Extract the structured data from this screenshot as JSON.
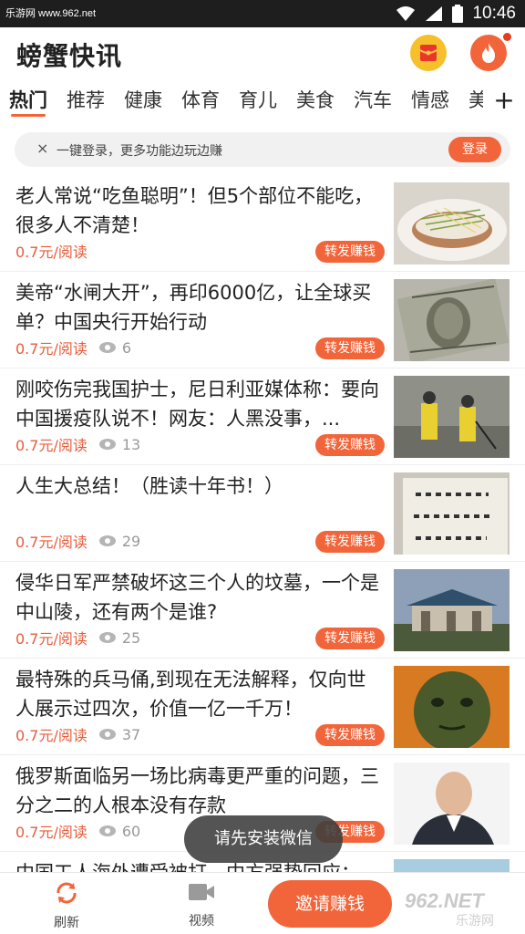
{
  "statusbar": {
    "watermark": "乐游网 www.962.net",
    "time": "10:46"
  },
  "header": {
    "title": "螃蟹快讯"
  },
  "tabs": [
    {
      "label": "热门",
      "active": true
    },
    {
      "label": "推荐",
      "active": false
    },
    {
      "label": "健康",
      "active": false
    },
    {
      "label": "体育",
      "active": false
    },
    {
      "label": "育儿",
      "active": false
    },
    {
      "label": "美食",
      "active": false
    },
    {
      "label": "汽车",
      "active": false
    },
    {
      "label": "情感",
      "active": false
    },
    {
      "label": "美",
      "active": false
    }
  ],
  "tab_add": "+",
  "login_banner": {
    "close": "×",
    "text": "一键登录，更多功能边玩边赚",
    "button": "登录"
  },
  "news": [
    {
      "title": "老人常说“吃鱼聪明”！但5个部位不能吃，很多人不清楚！",
      "reward": "0.7元/阅读",
      "views": "",
      "share": "转发赚钱",
      "thumb": "fish"
    },
    {
      "title": "美帝“水闸大开”，再印6000亿，让全球买单？中国央行开始行动",
      "reward": "0.7元/阅读",
      "views": "6",
      "share": "转发赚钱",
      "thumb": "dollar"
    },
    {
      "title": "刚咬伤完我国护士，尼日利亚媒体称：要向中国援疫队说不！网友：人黑没事，...",
      "reward": "0.7元/阅读",
      "views": "13",
      "share": "转发赚钱",
      "thumb": "workers"
    },
    {
      "title": "人生大总结！（胜读十年书！）",
      "reward": "0.7元/阅读",
      "views": "29",
      "share": "转发赚钱",
      "thumb": "calligraphy"
    },
    {
      "title": "侵华日军严禁破坏这三个人的坟墓，一个是中山陵，还有两个是谁?",
      "reward": "0.7元/阅读",
      "views": "25",
      "share": "转发赚钱",
      "thumb": "mausoleum"
    },
    {
      "title": "最特殊的兵马俑,到现在无法解释，仅向世人展示过四次，价值一亿一千万！",
      "reward": "0.7元/阅读",
      "views": "37",
      "share": "转发赚钱",
      "thumb": "terracotta"
    },
    {
      "title": "俄罗斯面临另一场比病毒更严重的问题，三分之二的人根本没有存款",
      "reward": "0.7元/阅读",
      "views": "60",
      "share": "转发赚钱",
      "thumb": "portrait"
    },
    {
      "title": "中国工人海外遭受被打，中方强势回应：",
      "reward": "",
      "views": "",
      "share": "",
      "thumb": "sea"
    }
  ],
  "toast": "请先安装微信",
  "bottom_nav": {
    "refresh": "刷新",
    "video": "视频",
    "invite": "邀请赚钱"
  },
  "brand_watermark": {
    "text": "962.NET",
    "sub": "乐游网"
  },
  "colors": {
    "accent": "#f2653a",
    "reward_text": "#e85c3a",
    "statusbar": "#1e1e1e"
  }
}
